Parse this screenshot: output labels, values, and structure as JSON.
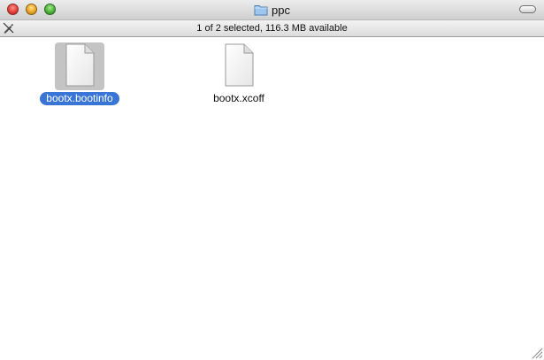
{
  "window": {
    "title": "ppc"
  },
  "status": {
    "text": "1 of 2 selected, 116.3 MB available"
  },
  "files": [
    {
      "name": "bootx.bootinfo",
      "selected": true,
      "icon": "document-icon"
    },
    {
      "name": "bootx.xcoff",
      "selected": false,
      "icon": "document-icon"
    }
  ],
  "colors": {
    "selection_label_bg": "#3875d7",
    "selection_icon_bg": "#c4c4c4"
  }
}
